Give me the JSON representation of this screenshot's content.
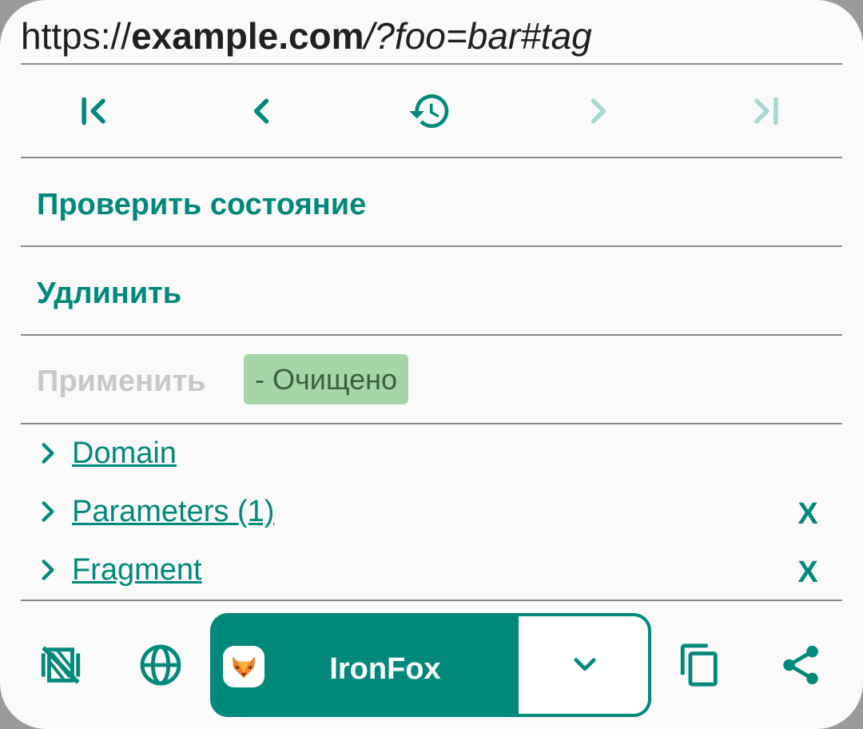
{
  "url": {
    "scheme": "https://",
    "host": "example.com",
    "rest": "/?foo=bar#tag"
  },
  "history_nav": {
    "items": [
      {
        "name": "first-icon",
        "enabled": true
      },
      {
        "name": "previous-icon",
        "enabled": true
      },
      {
        "name": "history-icon",
        "enabled": true
      },
      {
        "name": "next-icon",
        "enabled": false
      },
      {
        "name": "last-icon",
        "enabled": false
      }
    ]
  },
  "actions": {
    "check_status": "Проверить состояние",
    "unshorten": "Удлинить",
    "apply": "Применить",
    "cleaned_badge": "- Очищено"
  },
  "modules": {
    "items": [
      {
        "label": "Domain",
        "has_remove": false
      },
      {
        "label": "Parameters (1)",
        "has_remove": true
      },
      {
        "label": "Fragment",
        "has_remove": true
      }
    ],
    "remove_label": "X"
  },
  "bottom_bar": {
    "left_icons": [
      "no-ctabs-icon",
      "globe-icon"
    ],
    "browser_label": "IronFox",
    "browser_icon": "ironfox-logo-icon",
    "dropdown_icon": "chevron-down-icon",
    "right_icons": [
      "copy-icon",
      "share-icon"
    ]
  },
  "colors": {
    "accent": "#00897b",
    "accent_disabled": "#a8d8d2",
    "disabled_text": "#c8c8c8",
    "badge_bg": "#a5d6a7",
    "divider": "#8a8a8a",
    "background": "#fafafa"
  }
}
